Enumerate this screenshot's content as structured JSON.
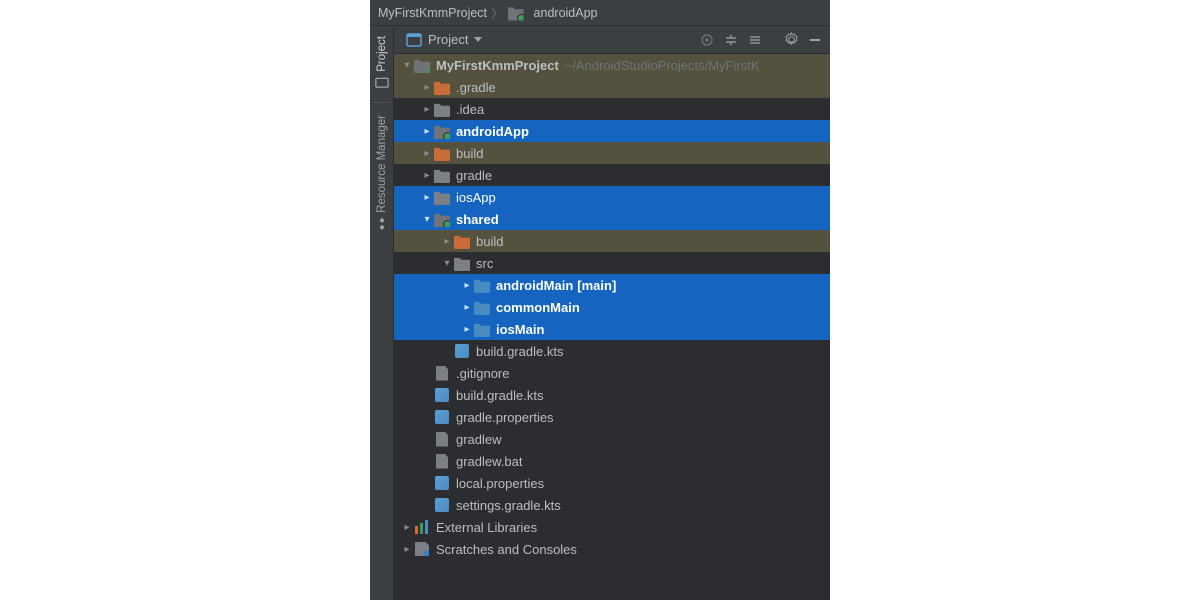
{
  "breadcrumb": {
    "items": [
      {
        "label": "MyFirstKmmProject"
      },
      {
        "label": "androidApp"
      }
    ]
  },
  "panel": {
    "title": "Project"
  },
  "sidebar": {
    "tabs": [
      {
        "label": "Project",
        "active": true
      },
      {
        "label": "Resource Manager",
        "active": false
      }
    ]
  },
  "tree": [
    {
      "depth": 0,
      "chev": "down",
      "icon": "folder-root",
      "label": "MyFirstKmmProject",
      "bold": true,
      "suffix": "~/AndroidStudioProjects/MyFirstK",
      "style": "shaded"
    },
    {
      "depth": 1,
      "chev": "right",
      "icon": "folder-excl",
      "label": ".gradle",
      "style": "shaded"
    },
    {
      "depth": 1,
      "chev": "right",
      "icon": "folder",
      "label": ".idea"
    },
    {
      "depth": 1,
      "chev": "right",
      "icon": "folder-mod",
      "label": "androidApp",
      "bold": true,
      "style": "selected"
    },
    {
      "depth": 1,
      "chev": "right",
      "icon": "folder-excl",
      "label": "build",
      "style": "shaded"
    },
    {
      "depth": 1,
      "chev": "right",
      "icon": "folder",
      "label": "gradle"
    },
    {
      "depth": 1,
      "chev": "right",
      "icon": "folder",
      "label": "iosApp",
      "style": "selected"
    },
    {
      "depth": 1,
      "chev": "down",
      "icon": "folder-mod",
      "label": "shared",
      "bold": true,
      "style": "selected"
    },
    {
      "depth": 2,
      "chev": "right",
      "icon": "folder-excl",
      "label": "build",
      "style": "shaded"
    },
    {
      "depth": 2,
      "chev": "down",
      "icon": "folder",
      "label": "src"
    },
    {
      "depth": 3,
      "chev": "right",
      "icon": "folder-src",
      "label": "androidMain",
      "bold": true,
      "tag": "[main]",
      "style": "selected"
    },
    {
      "depth": 3,
      "chev": "right",
      "icon": "folder-src",
      "label": "commonMain",
      "bold": true,
      "style": "selected"
    },
    {
      "depth": 3,
      "chev": "right",
      "icon": "folder-src",
      "label": "iosMain",
      "bold": true,
      "style": "selected"
    },
    {
      "depth": 2,
      "chev": "",
      "icon": "file-gradle",
      "label": "build.gradle.kts"
    },
    {
      "depth": 1,
      "chev": "",
      "icon": "file-generic",
      "label": ".gitignore"
    },
    {
      "depth": 1,
      "chev": "",
      "icon": "file-gradle",
      "label": "build.gradle.kts"
    },
    {
      "depth": 1,
      "chev": "",
      "icon": "file-gradle",
      "label": "gradle.properties"
    },
    {
      "depth": 1,
      "chev": "",
      "icon": "file-generic",
      "label": "gradlew"
    },
    {
      "depth": 1,
      "chev": "",
      "icon": "file-generic",
      "label": "gradlew.bat"
    },
    {
      "depth": 1,
      "chev": "",
      "icon": "file-gradle",
      "label": "local.properties"
    },
    {
      "depth": 1,
      "chev": "",
      "icon": "file-gradle",
      "label": "settings.gradle.kts"
    },
    {
      "depth": 0,
      "chev": "right",
      "icon": "file-libs",
      "label": "External Libraries"
    },
    {
      "depth": 0,
      "chev": "right",
      "icon": "file-scratch",
      "label": "Scratches and Consoles"
    }
  ]
}
